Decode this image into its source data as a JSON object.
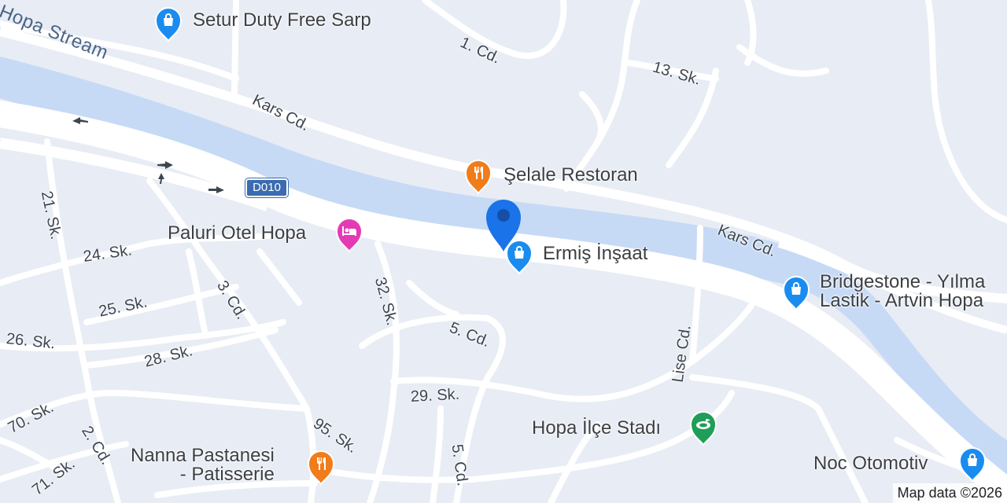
{
  "map": {
    "colors": {
      "land": "#e8ecf4",
      "road": "#ffffff",
      "water": "#c6daf6",
      "route_badge": "#3b6bb0",
      "pin_shop": "#1a8cf0",
      "pin_food": "#f07c1a",
      "pin_hotel": "#e43bb4",
      "pin_stadium": "#1e9e58",
      "location_pin": "#1a73e8"
    },
    "water_label": "Hopa Stream",
    "route_badge": "D010",
    "streets": [
      {
        "id": "1-cd",
        "text": "1. Cd."
      },
      {
        "id": "13-sk",
        "text": "13. Sk."
      },
      {
        "id": "kars-cd-west",
        "text": "Kars Cd."
      },
      {
        "id": "kars-cd-east",
        "text": "Kars Cd."
      },
      {
        "id": "21-sk",
        "text": "21. Sk."
      },
      {
        "id": "24-sk",
        "text": "24. Sk."
      },
      {
        "id": "3-cd",
        "text": "3. Cd."
      },
      {
        "id": "25-sk",
        "text": "25. Sk."
      },
      {
        "id": "26-sk",
        "text": "26. Sk."
      },
      {
        "id": "28-sk",
        "text": "28. Sk."
      },
      {
        "id": "32-sk",
        "text": "32. Sk."
      },
      {
        "id": "5-cd-north",
        "text": "5. Cd."
      },
      {
        "id": "lise-cd",
        "text": "Lise Cd."
      },
      {
        "id": "29-sk",
        "text": "29. Sk."
      },
      {
        "id": "5-cd-south",
        "text": "5. Cd."
      },
      {
        "id": "95-sk",
        "text": "95. Sk."
      },
      {
        "id": "70-sk",
        "text": "70. Sk."
      },
      {
        "id": "2-cd",
        "text": "2. Cd."
      },
      {
        "id": "71-sk",
        "text": "71. Sk."
      }
    ],
    "pois": [
      {
        "id": "setur",
        "icon": "shopping-bag-icon",
        "line1": "Setur Duty Free Sarp",
        "line2": ""
      },
      {
        "id": "selale",
        "icon": "restaurant-icon",
        "line1": "Şelale Restoran",
        "line2": ""
      },
      {
        "id": "paluri",
        "icon": "hotel-bed-icon",
        "line1": "Paluri Otel Hopa",
        "line2": ""
      },
      {
        "id": "ermis",
        "icon": "shopping-bag-icon",
        "line1": "Ermiş İnşaat",
        "line2": ""
      },
      {
        "id": "bridgestone",
        "icon": "shopping-bag-icon",
        "line1": "Bridgestone - Yılma",
        "line2": "Lastik - Artvin Hopa"
      },
      {
        "id": "stadium",
        "icon": "stadium-icon",
        "line1": "Hopa İlçe Stadı",
        "line2": ""
      },
      {
        "id": "nanna",
        "icon": "restaurant-icon",
        "line1": "Nanna Pastanesi",
        "line2": "- Patisserie"
      },
      {
        "id": "noc",
        "icon": "shopping-bag-icon",
        "line1": "Noc Otomotiv",
        "line2": ""
      }
    ],
    "attribution": "Map data ©2026"
  }
}
